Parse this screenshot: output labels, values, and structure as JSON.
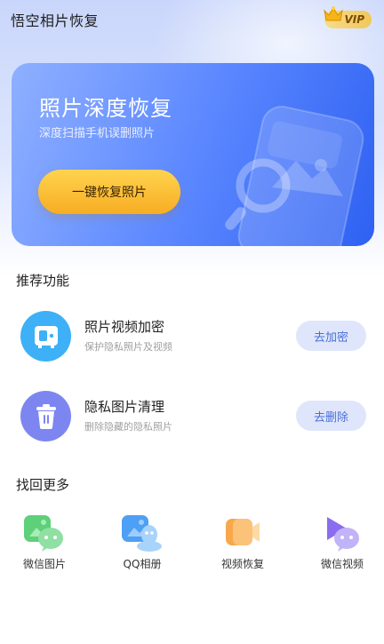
{
  "header": {
    "app_title": "悟空相片恢复",
    "vip_label": "VIP"
  },
  "hero": {
    "title": "照片深度恢复",
    "subtitle": "深度扫描手机误删照片",
    "button_label": "一键恢复照片"
  },
  "recommend": {
    "section_title": "推荐功能",
    "items": [
      {
        "title": "照片视频加密",
        "subtitle": "保护隐私照片及视频",
        "button": "去加密",
        "icon": "safe-icon"
      },
      {
        "title": "隐私图片清理",
        "subtitle": "删除隐藏的隐私照片",
        "button": "去删除",
        "icon": "trash-icon"
      }
    ]
  },
  "more": {
    "section_title": "找回更多",
    "items": [
      {
        "label": "微信图片",
        "icon": "wechat-image-icon"
      },
      {
        "label": "QQ相册",
        "icon": "qq-album-icon"
      },
      {
        "label": "视频恢复",
        "icon": "video-recovery-icon"
      },
      {
        "label": "微信视频",
        "icon": "wechat-video-icon"
      }
    ]
  },
  "colors": {
    "accent_blue": "#3a6af5",
    "button_yellow": "#f7b52a",
    "pill_bg": "#dfe6fb",
    "pill_text": "#4a70d8"
  }
}
